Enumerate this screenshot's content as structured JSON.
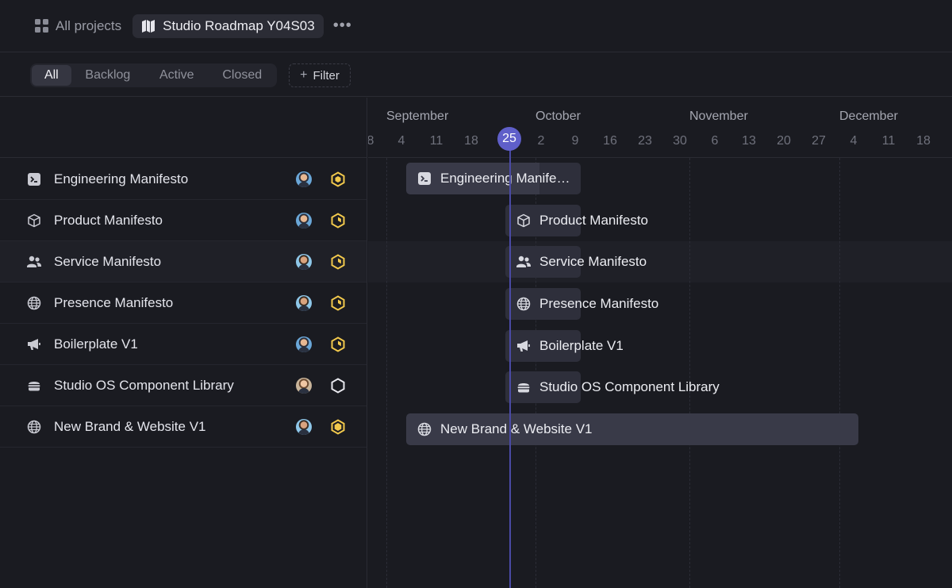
{
  "header": {
    "all_projects_label": "All projects",
    "roadmap_title": "Studio Roadmap Y04S03",
    "more_label": "•••"
  },
  "filters": {
    "tabs": [
      "All",
      "Backlog",
      "Active",
      "Closed"
    ],
    "active_tab": "All",
    "filter_label": "Filter",
    "filter_plus": "+"
  },
  "timeline": {
    "months": [
      "September",
      "October",
      "November",
      "December"
    ],
    "days": [
      "8",
      "4",
      "11",
      "18",
      "2",
      "9",
      "16",
      "23",
      "30",
      "6",
      "13",
      "20",
      "27",
      "4",
      "11",
      "18"
    ],
    "today": "25"
  },
  "projects": [
    {
      "name": "Engineering Manifesto",
      "bar_label": "Engineering Manife…",
      "icon": "terminal-icon",
      "status": "in-progress-half"
    },
    {
      "name": "Product Manifesto",
      "bar_label": "Product Manifesto",
      "icon": "cube-icon",
      "status": "planned"
    },
    {
      "name": "Service Manifesto",
      "bar_label": "Service Manifesto",
      "icon": "users-icon",
      "status": "planned"
    },
    {
      "name": "Presence Manifesto",
      "bar_label": "Presence Manifesto",
      "icon": "globe-icon",
      "status": "planned"
    },
    {
      "name": "Boilerplate V1",
      "bar_label": "Boilerplate V1",
      "icon": "megaphone-icon",
      "status": "planned"
    },
    {
      "name": "Studio OS Component Library",
      "bar_label": "Studio OS Component Library",
      "icon": "stack-icon",
      "status": "backlog"
    },
    {
      "name": "New Brand & Website V1",
      "bar_label": "New Brand & Website V1",
      "icon": "globe-icon",
      "status": "in-progress-full"
    }
  ],
  "colors": {
    "accent": "#5f5fc9",
    "status_yellow": "#f2c94c",
    "background": "#1a1b21"
  }
}
